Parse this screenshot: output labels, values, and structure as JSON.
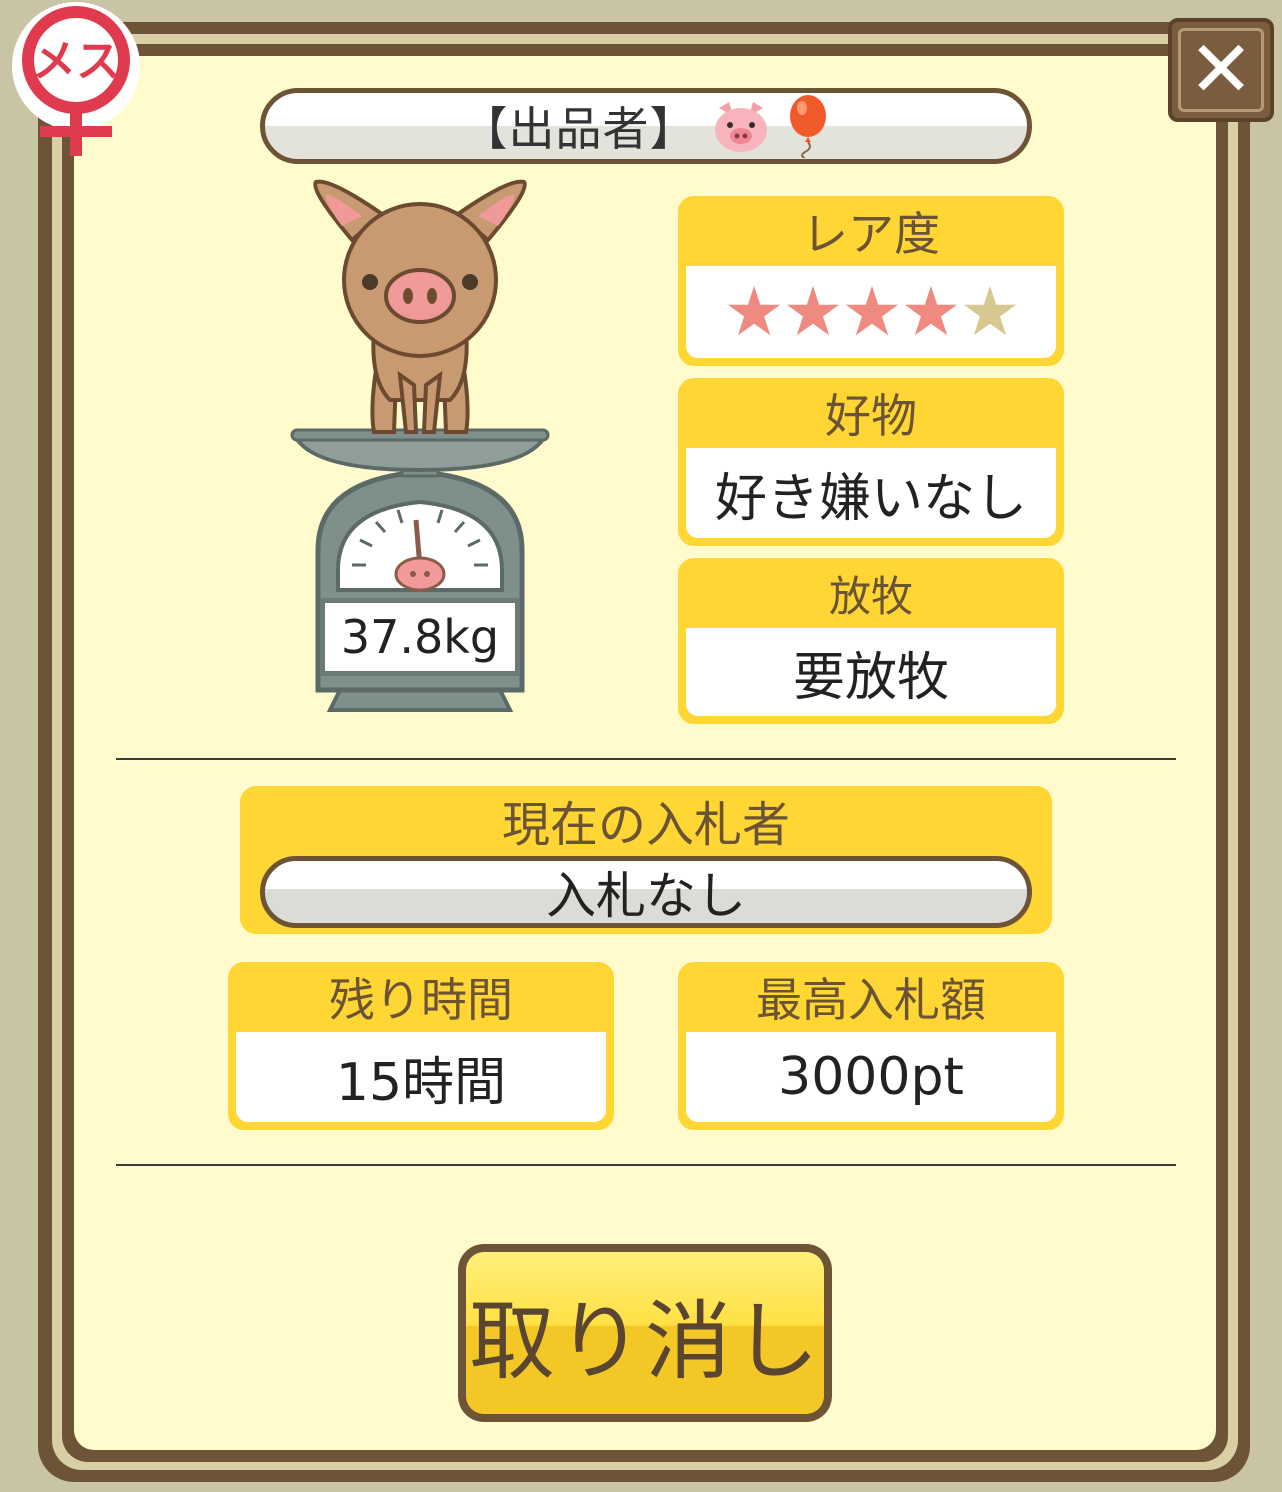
{
  "dialog": {
    "gender_badge": "メス",
    "close_glyph": "✕",
    "seller": {
      "label": "【出品者】",
      "icons": [
        "pig-face-icon",
        "balloon-icon"
      ]
    },
    "weight": "37.8kg",
    "rarity": {
      "title": "レア度",
      "stars_filled": 4,
      "stars_total": 5
    },
    "favorite": {
      "title": "好物",
      "value": "好き嫌いなし"
    },
    "grazing": {
      "title": "放牧",
      "value": "要放牧"
    },
    "bidder": {
      "title": "現在の入札者",
      "value": "入札なし"
    },
    "time_left": {
      "title": "残り時間",
      "value": "15時間"
    },
    "top_bid": {
      "title": "最高入札額",
      "value": "3000pt"
    },
    "cancel_label": "取り消し"
  },
  "colors": {
    "panel": "#fffbcc",
    "card_header": "#ffd633",
    "frame_brown": "#6e5436",
    "star_on": "#ef8a80",
    "star_off": "#d7c891"
  }
}
